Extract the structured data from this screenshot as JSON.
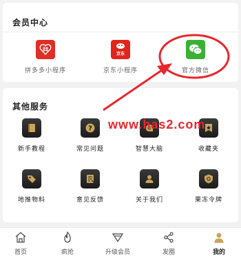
{
  "member_center": {
    "title": "会员中心",
    "items": [
      {
        "label": "拼多多小程序",
        "icon": "pinduoduo-icon",
        "color": "#e02e24"
      },
      {
        "label": "京东小程序",
        "icon": "jd-icon",
        "color": "#e1251b",
        "icon_text": "京东"
      },
      {
        "label": "官方微信",
        "icon": "wechat-icon",
        "color": "#3cb034"
      }
    ]
  },
  "services": {
    "title": "其他服务",
    "items": [
      {
        "label": "新手教程",
        "icon": "book-icon"
      },
      {
        "label": "常见问题",
        "icon": "question-icon"
      },
      {
        "label": "智慧大脑",
        "icon": "brain-icon"
      },
      {
        "label": "收藏夹",
        "icon": "bookmark-star-icon"
      },
      {
        "label": "地推物料",
        "icon": "tag-icon"
      },
      {
        "label": "意见反馈",
        "icon": "feedback-icon"
      },
      {
        "label": "关于我们",
        "icon": "user-icon"
      },
      {
        "label": "果冻令牌",
        "icon": "shield-icon"
      }
    ]
  },
  "tabbar": {
    "items": [
      {
        "label": "首页",
        "icon": "home-icon",
        "active": false
      },
      {
        "label": "疯抢",
        "icon": "fire-icon",
        "active": false
      },
      {
        "label": "升级会员",
        "icon": "diamond-icon",
        "active": false
      },
      {
        "label": "发圈",
        "icon": "share-icon",
        "active": false
      },
      {
        "label": "我的",
        "icon": "profile-icon",
        "active": true
      }
    ]
  },
  "annotation": {
    "watermark": "www.has2.com",
    "color": "#e8262d"
  },
  "colors": {
    "background": "#f2f2f2",
    "card": "#ffffff",
    "icon_dark": "#1b1b1b",
    "icon_gold": "#c9a55c"
  }
}
